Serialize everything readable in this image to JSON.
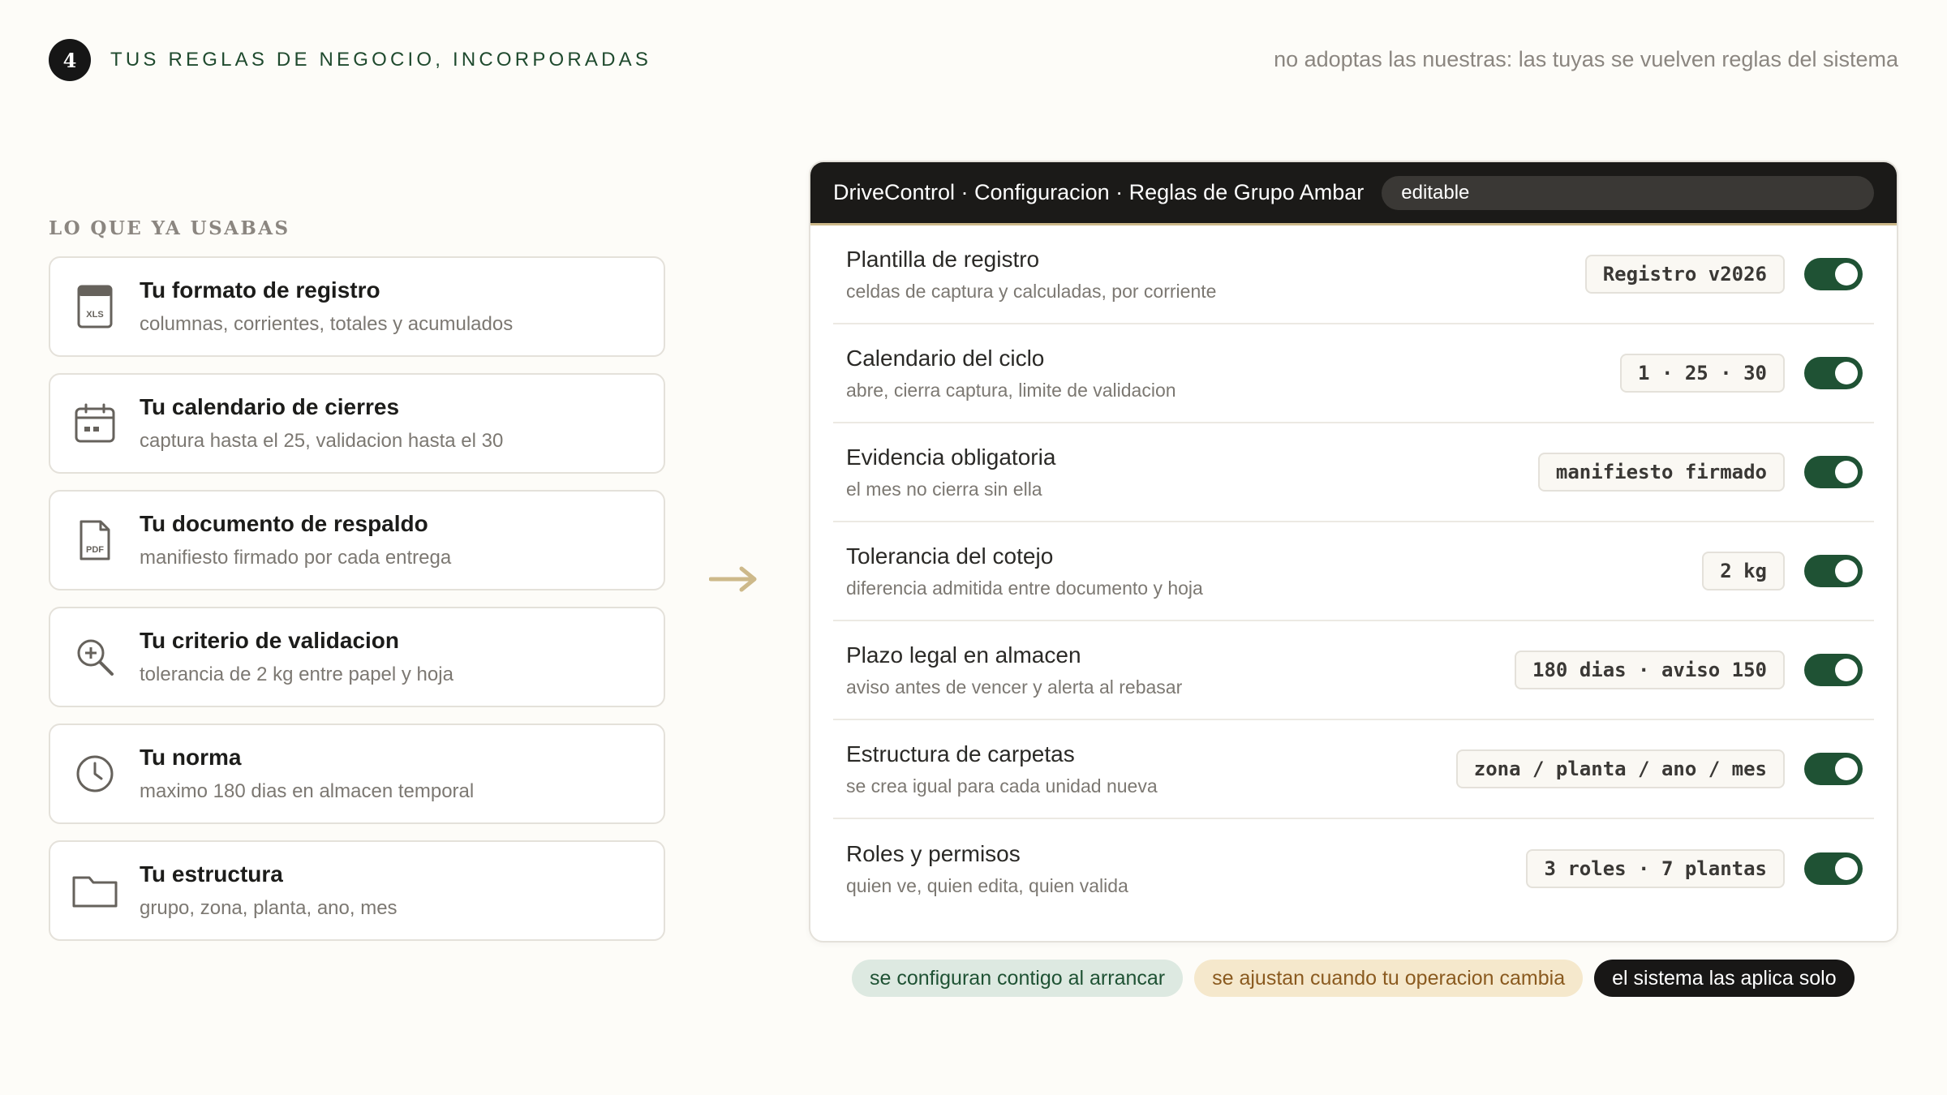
{
  "header": {
    "step_number": "4",
    "title": "TUS REGLAS DE NEGOCIO, INCORPORADAS",
    "tagline": "no adoptas las nuestras: las tuyas se vuelven reglas del sistema"
  },
  "left": {
    "label": "LO QUE YA USABAS",
    "cards": [
      {
        "icon": "xls-file-icon",
        "title": "Tu formato de registro",
        "subtitle": "columnas, corrientes, totales y acumulados"
      },
      {
        "icon": "calendar-icon",
        "title": "Tu calendario de cierres",
        "subtitle": "captura hasta el 25, validacion hasta el 30"
      },
      {
        "icon": "pdf-file-icon",
        "title": "Tu documento de respaldo",
        "subtitle": "manifiesto firmado por cada entrega"
      },
      {
        "icon": "zoom-in-icon",
        "title": "Tu criterio de validacion",
        "subtitle": "tolerancia de 2 kg entre papel y hoja"
      },
      {
        "icon": "clock-icon",
        "title": "Tu norma",
        "subtitle": "maximo 180 dias en almacen temporal"
      },
      {
        "icon": "folder-icon",
        "title": "Tu estructura",
        "subtitle": "grupo, zona, planta, ano, mes"
      }
    ]
  },
  "panel": {
    "title": "DriveControl · Configuracion · Reglas de Grupo Ambar",
    "badge": "editable",
    "rows": [
      {
        "title": "Plantilla de registro",
        "subtitle": "celdas de captura y calculadas, por corriente",
        "value": "Registro v2026",
        "enabled": true
      },
      {
        "title": "Calendario del ciclo",
        "subtitle": "abre, cierra captura, limite de validacion",
        "value": "1 · 25 · 30",
        "enabled": true
      },
      {
        "title": "Evidencia obligatoria",
        "subtitle": "el mes no cierra sin ella",
        "value": "manifiesto firmado",
        "enabled": true
      },
      {
        "title": "Tolerancia del cotejo",
        "subtitle": "diferencia admitida entre documento y hoja",
        "value": "2 kg",
        "enabled": true
      },
      {
        "title": "Plazo legal en almacen",
        "subtitle": "aviso antes de vencer y alerta al rebasar",
        "value": "180 dias · aviso 150",
        "enabled": true
      },
      {
        "title": "Estructura de carpetas",
        "subtitle": "se crea igual para cada unidad nueva",
        "value": "zona / planta / ano / mes",
        "enabled": true
      },
      {
        "title": "Roles y permisos",
        "subtitle": "quien ve, quien edita, quien valida",
        "value": "3 roles · 7 plantas",
        "enabled": true
      }
    ]
  },
  "pills": [
    {
      "label": "se configuran contigo al arrancar",
      "style": "green"
    },
    {
      "label": "se ajustan cuando tu operacion cambia",
      "style": "beige"
    },
    {
      "label": "el sistema las aplica solo",
      "style": "dark"
    }
  ],
  "colors": {
    "accent_green": "#1f5234",
    "title_green": "#1f4a2e",
    "arrow_gold": "#cdb98a",
    "panel_header": "#1b1a18"
  }
}
